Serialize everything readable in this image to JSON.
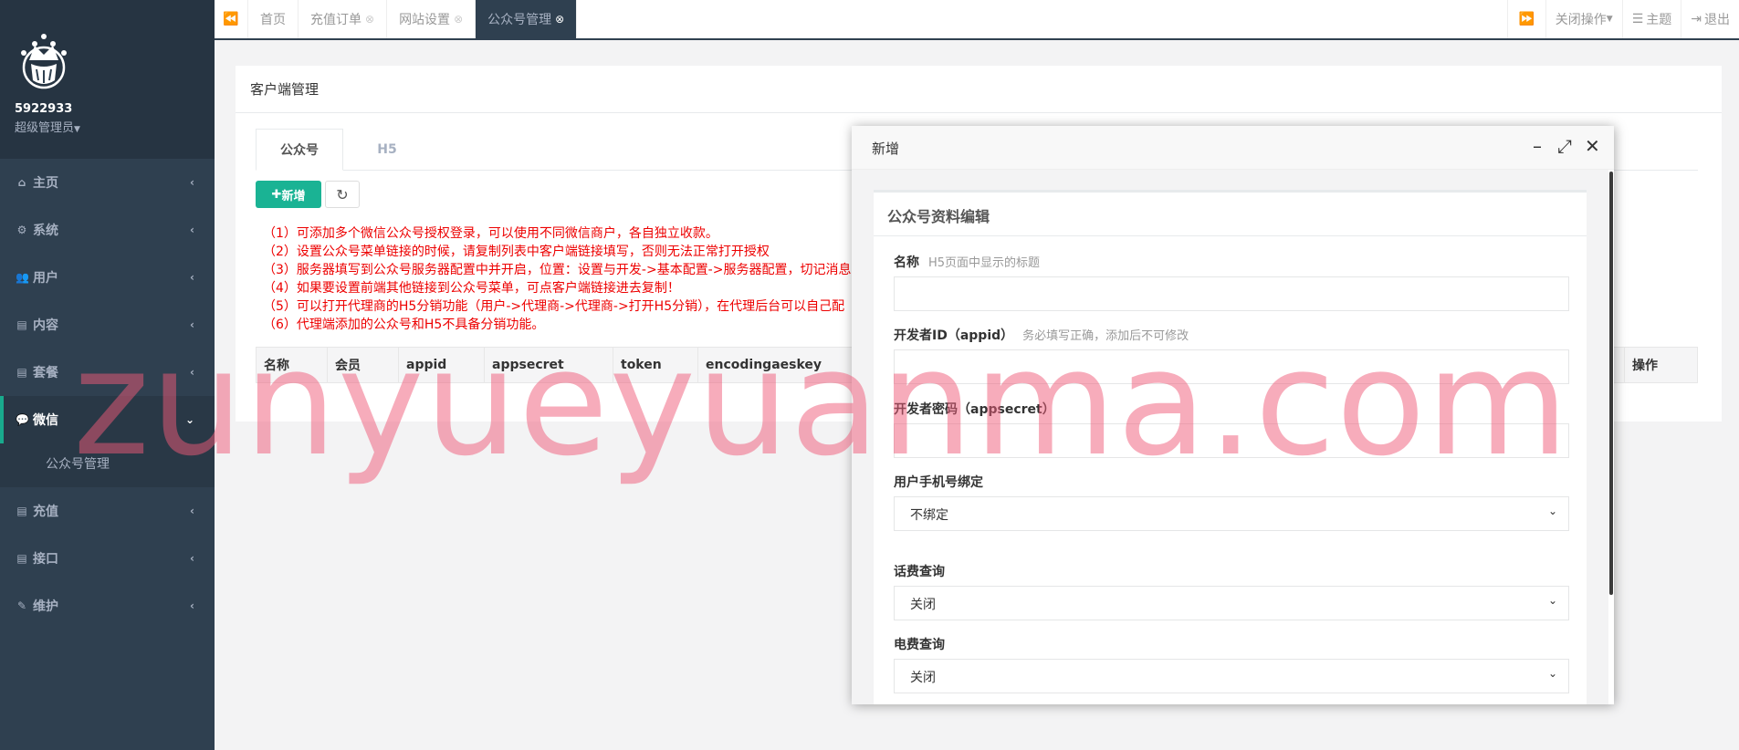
{
  "profile": {
    "name": "5922933",
    "role": "超级管理员"
  },
  "sidebar": {
    "items": [
      {
        "label": "主页",
        "icon": "home-icon"
      },
      {
        "label": "系统",
        "icon": "cogs-icon"
      },
      {
        "label": "用户",
        "icon": "users-icon"
      },
      {
        "label": "内容",
        "icon": "file-icon"
      },
      {
        "label": "套餐",
        "icon": "file-icon"
      },
      {
        "label": "微信",
        "icon": "wechat-icon",
        "active": true
      },
      {
        "label": "充值",
        "icon": "file-icon"
      },
      {
        "label": "接口",
        "icon": "file-icon"
      },
      {
        "label": "维护",
        "icon": "magic-icon"
      }
    ],
    "sub_item": "公众号管理"
  },
  "tabs": {
    "items": [
      "首页",
      "充值订单",
      "网站设置",
      "公众号管理"
    ],
    "active": "公众号管理",
    "close_ops": "关闭操作",
    "theme": "主题",
    "logout": "退出"
  },
  "panel": {
    "title": "客户端管理",
    "inner_tabs": [
      "公众号",
      "H5"
    ],
    "add_button": "新增",
    "notes": [
      "（1）可添加多个微信公众号授权登录，可以使用不同微信商户，各自独立收款。",
      "（2）设置公众号菜单链接的时候，请复制列表中客户端链接填写，否则无法正常打开授权",
      "（3）服务器填写到公众号服务器配置中并开启，位置：设置与开发->基本配置->服务器配置，切记消息",
      "（4）如果要设置前端其他链接到公众号菜单，可点客户端链接进去复制！",
      "（5）可以打开代理商的H5分销功能（用户->代理商->代理商->打开H5分销），在代理后台可以自己配",
      "（6）代理端添加的公众号和H5不具备分销功能。"
    ],
    "table_headers": [
      "名称",
      "会员",
      "appid",
      "appsecret",
      "token",
      "encodingaeskey"
    ],
    "table_last_header": "操作"
  },
  "modal": {
    "title": "新增",
    "form_title": "公众号资料编辑",
    "fields": {
      "name_label": "名称",
      "name_hint": "H5页面中显示的标题",
      "appid_label": "开发者ID（appid）",
      "appid_hint": "务必填写正确，添加后不可修改",
      "secret_label": "开发者密码（appsecret）",
      "phone_label": "用户手机号绑定",
      "phone_value": "不绑定",
      "fee_label": "话费查询",
      "fee_value": "关闭",
      "elec_label": "电费查询",
      "elec_value": "关闭"
    }
  },
  "watermark": "zunyueyuanma.com",
  "colors": {
    "sidebar": "#2f4050",
    "accent": "#1ab394",
    "note_red": "#ed0000"
  }
}
